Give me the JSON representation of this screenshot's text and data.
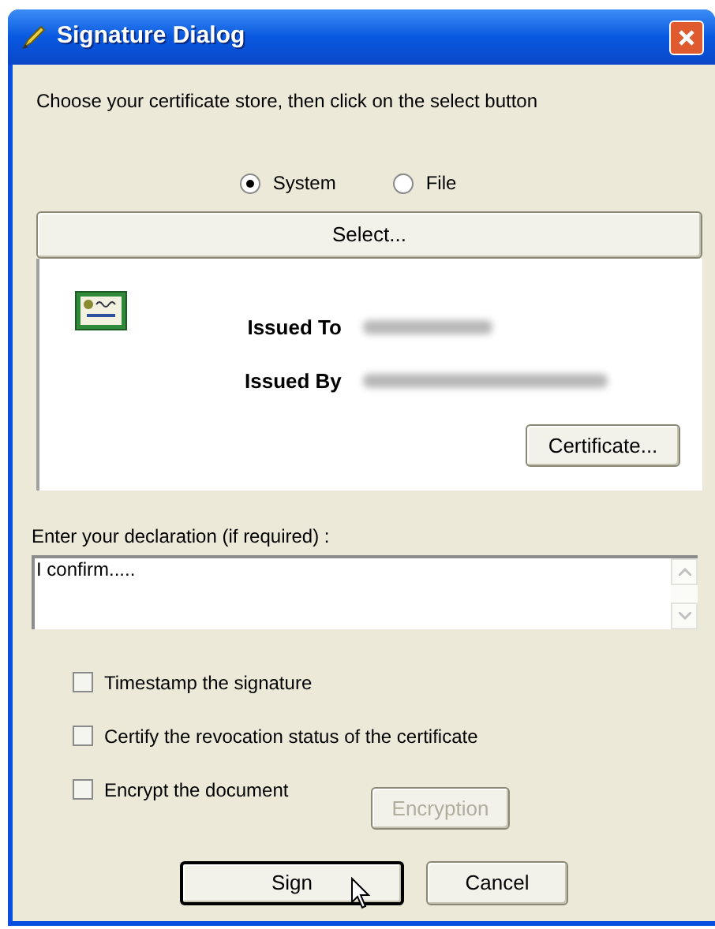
{
  "window": {
    "title": "Signature Dialog"
  },
  "instruction": "Choose your certificate store, then click on the select button",
  "store_options": [
    {
      "label": "System",
      "selected": true
    },
    {
      "label": "File",
      "selected": false
    }
  ],
  "select_button": "Select...",
  "certificate": {
    "issued_to_label": "Issued To",
    "issued_by_label": "Issued By",
    "certificate_button": "Certificate..."
  },
  "declaration": {
    "label": "Enter your declaration (if required) :",
    "value": "I confirm....."
  },
  "options": [
    {
      "label": "Timestamp the signature",
      "checked": false
    },
    {
      "label": "Certify the revocation status of the certificate",
      "checked": false
    },
    {
      "label": "Encrypt the document",
      "checked": false
    }
  ],
  "encryption_button": {
    "label": "Encryption",
    "disabled": true
  },
  "buttons": [
    {
      "label": "Sign",
      "selected": true
    },
    {
      "label": "Cancel",
      "selected": false
    }
  ]
}
